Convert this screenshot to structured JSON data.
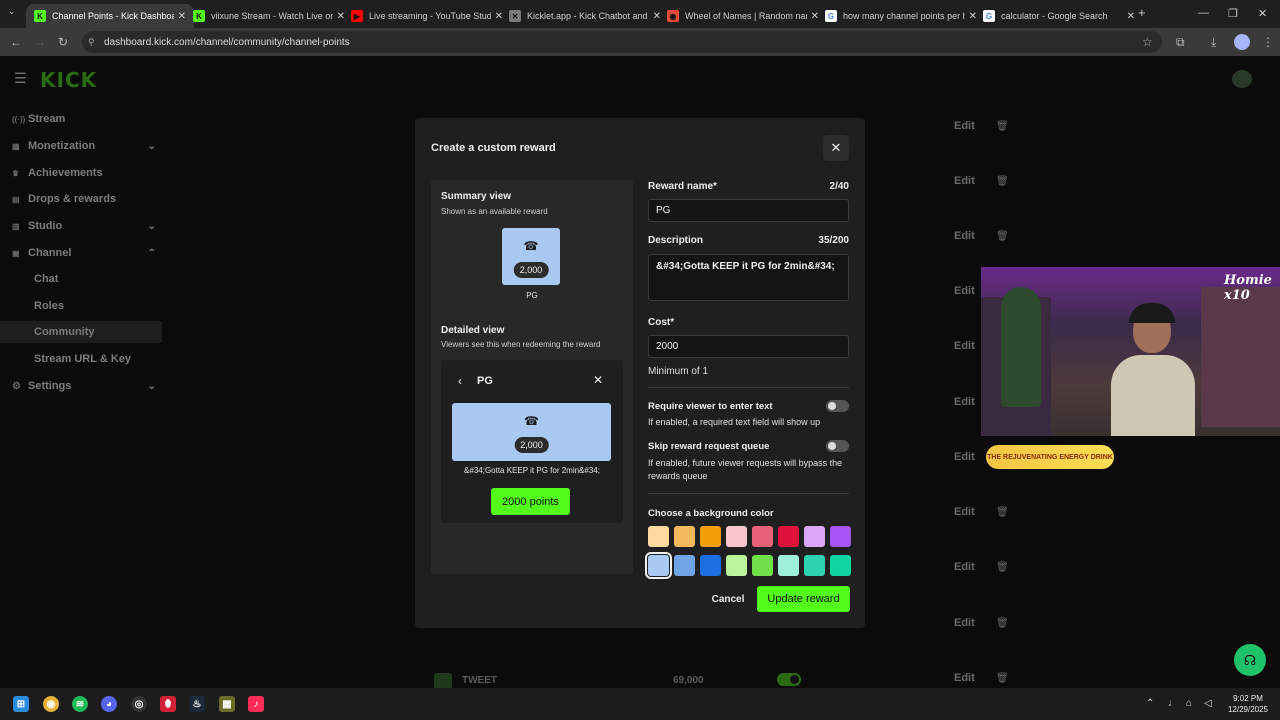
{
  "browser": {
    "tabs": [
      {
        "title": "Channel Points - Kick Dashboard",
        "icon": "kick-icon",
        "color": "#53fc18",
        "glyph": "K",
        "active": true
      },
      {
        "title": "viixune Stream - Watch Live on",
        "icon": "kick-icon",
        "color": "#53fc18",
        "glyph": "K",
        "active": false
      },
      {
        "title": "Live streaming - YouTube Studio",
        "icon": "youtube-icon",
        "color": "#ff0000",
        "glyph": "▶",
        "active": false
      },
      {
        "title": "Kicklet.app - Kick Chatbot and",
        "icon": "kicklet-icon",
        "color": "#7a7a7a",
        "glyph": "✕",
        "active": false
      },
      {
        "title": "Wheel of Names | Random nam",
        "icon": "wheel-icon",
        "color": "#e84a3c",
        "glyph": "◉",
        "active": false
      },
      {
        "title": "how many channel points per h",
        "icon": "google-icon",
        "color": "#ffffff",
        "glyph": "G",
        "active": false
      },
      {
        "title": "calculator - Google Search",
        "icon": "google-icon",
        "color": "#ffffff",
        "glyph": "G",
        "active": false
      }
    ],
    "url": "dashboard.kick.com/channel/community/channel-points"
  },
  "sidebar": {
    "logo": "KICK",
    "items": [
      {
        "label": "Stream",
        "icon": "broadcast-icon",
        "glyph": "((·))",
        "chevron": ""
      },
      {
        "label": "Monetization",
        "icon": "money-icon",
        "glyph": "▦",
        "chevron": "⌄"
      },
      {
        "label": "Achievements",
        "icon": "trophy-icon",
        "glyph": "♛",
        "chevron": ""
      },
      {
        "label": "Drops & rewards",
        "icon": "gift-icon",
        "glyph": "▤",
        "chevron": ""
      },
      {
        "label": "Studio",
        "icon": "studio-icon",
        "glyph": "▥",
        "chevron": "⌄"
      },
      {
        "label": "Channel",
        "icon": "channel-icon",
        "glyph": "▣",
        "chevron": "⌃"
      }
    ],
    "subitems": [
      "Chat",
      "Roles",
      "Community",
      "Stream URL & Key"
    ],
    "settings": {
      "label": "Settings",
      "icon": "gear-icon",
      "glyph": "⚙",
      "chevron": "⌄"
    }
  },
  "background_list": {
    "edit_label": "Edit",
    "visible_row": {
      "name": "TWEET",
      "cost": "69,000"
    }
  },
  "modal": {
    "title": "Create a custom reward",
    "summary": {
      "heading": "Summary view",
      "sub": "Shown as an available reward",
      "cost_pill": "2,000",
      "name": "PG"
    },
    "detail": {
      "heading": "Detailed view",
      "sub": "Viewers see this when redeeming the reward",
      "name": "PG",
      "cost_pill": "2,000",
      "description": "&#34;Gotta KEEP it PG for 2min&#34;",
      "points_button": "2000 points"
    },
    "reward_name": {
      "label": "Reward name*",
      "counter": "2/40",
      "value": "PG"
    },
    "description": {
      "label": "Description",
      "counter": "35/200",
      "value": "&#34;Gotta KEEP it PG for 2min&#34;"
    },
    "cost": {
      "label": "Cost*",
      "value": "2000",
      "hint": "Minimum of 1"
    },
    "require_text": {
      "label": "Require viewer to enter text",
      "hint": "If enabled, a required text field will show up",
      "enabled": false
    },
    "skip_queue": {
      "label": "Skip reward request queue",
      "hint": "If enabled, future viewer requests will bypass the rewards queue",
      "enabled": false
    },
    "bg_color": {
      "label": "Choose a background color",
      "colors": [
        "#fdd9a0",
        "#f5b85c",
        "#f59e0b",
        "#f9c6cf",
        "#e8607a",
        "#e0113c",
        "#d9a7f5",
        "#a855f7",
        "#a9c9f2",
        "#6ea4e6",
        "#1c6fe0",
        "#b9f59a",
        "#6fe04a",
        "#9ff0d9",
        "#2ed1b0",
        "#0fd6a0"
      ],
      "selected": 8
    },
    "cancel_label": "Cancel",
    "update_label": "Update reward"
  },
  "overlay": {
    "brand": "Homie x10",
    "energy": "THE REJUVENATING ENERGY DRINK"
  },
  "taskbar": {
    "time": "9:02 PM",
    "date": "12/29/2025"
  }
}
